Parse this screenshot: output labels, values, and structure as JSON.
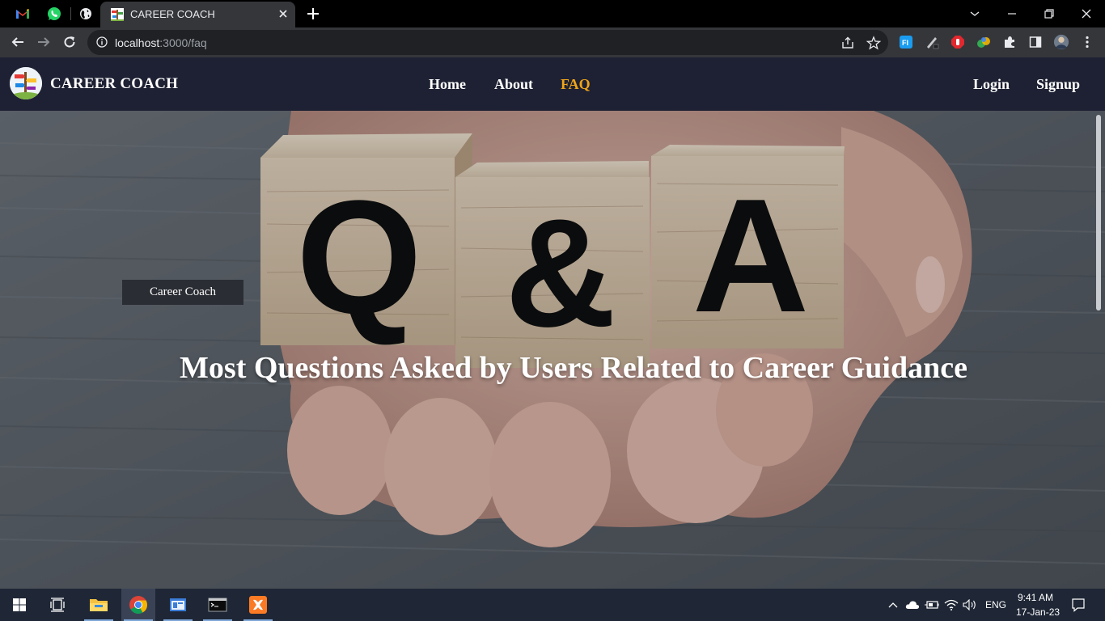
{
  "browser": {
    "tab_title": "CAREER COACH",
    "url_host": "localhost",
    "url_path": ":3000/faq"
  },
  "site": {
    "brand": "CAREER COACH",
    "nav": {
      "home": "Home",
      "about": "About",
      "faq": "FAQ",
      "login": "Login",
      "signup": "Signup"
    },
    "active_nav": "faq",
    "colors": {
      "navbar_bg": "#1e2133",
      "active_link": "#f0a418"
    }
  },
  "hero": {
    "pill_label": "Career Coach",
    "title": "Most Questions Asked by Users Related to Career Guidance",
    "image_text": {
      "block1": "Q",
      "block2": "&",
      "block3": "A"
    }
  },
  "taskbar": {
    "language": "ENG",
    "time": "9:41 AM",
    "date": "17-Jan-23"
  }
}
